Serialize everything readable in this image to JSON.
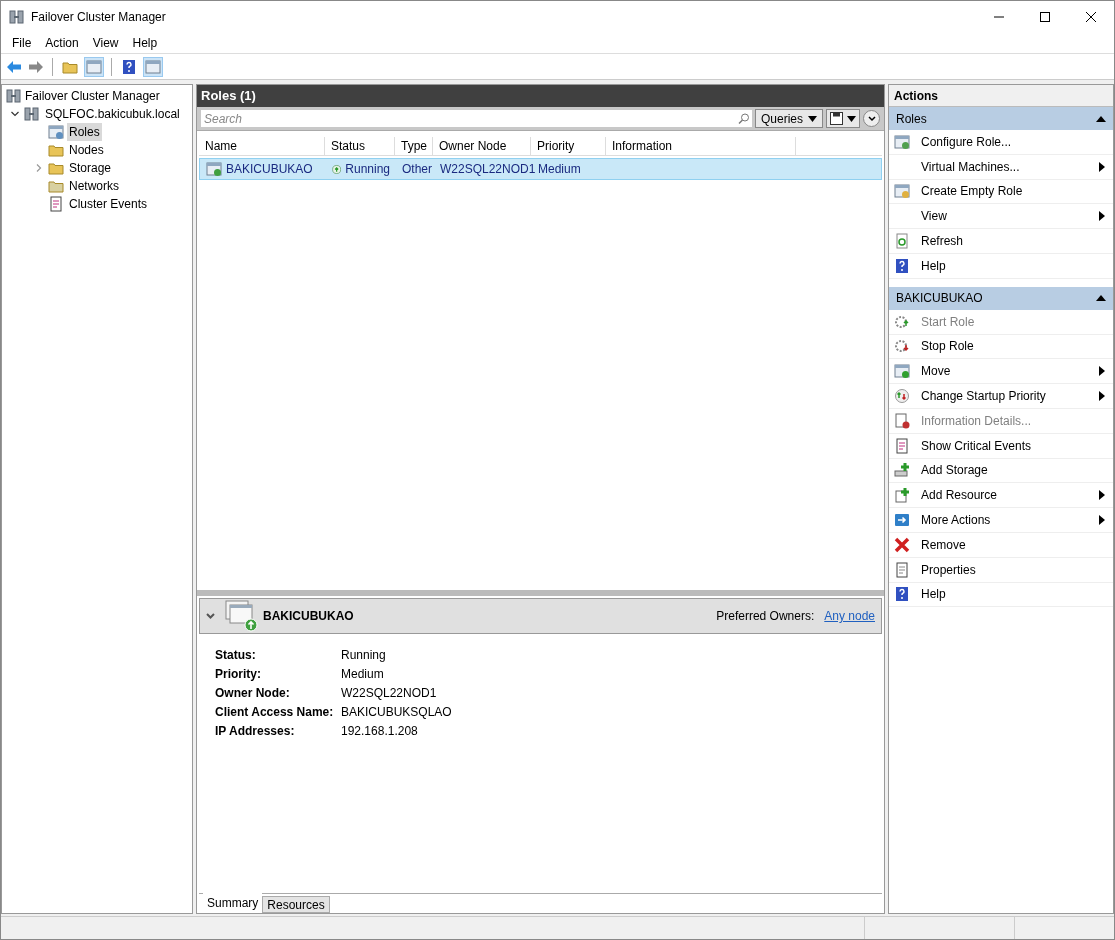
{
  "window": {
    "title": "Failover Cluster Manager"
  },
  "menu": [
    "File",
    "Action",
    "View",
    "Help"
  ],
  "tree": {
    "label": "Failover Cluster Manager",
    "children": [
      {
        "label": "SQLFOC.bakicubuk.local",
        "expanded": true,
        "selected": false,
        "children": [
          {
            "label": "Roles",
            "selected": true
          },
          {
            "label": "Nodes",
            "selected": false
          },
          {
            "label": "Storage",
            "selected": false,
            "expanded": false
          },
          {
            "label": "Networks",
            "selected": false
          },
          {
            "label": "Cluster Events",
            "selected": false
          }
        ]
      }
    ]
  },
  "roles": {
    "title": "Roles (1)",
    "search": {
      "placeholder": "Search"
    },
    "queries_button": "Queries",
    "columns": [
      "Name",
      "Status",
      "Type",
      "Owner Node",
      "Priority",
      "Information"
    ],
    "rows": [
      {
        "name": "BAKICUBUKAO",
        "status": "Running",
        "type": "Other",
        "owner_node": "W22SQL22NOD1",
        "priority": "Medium",
        "selected": true
      }
    ]
  },
  "detail": {
    "name": "BAKICUBUKAO",
    "preferred_owners_label": "Preferred Owners:",
    "preferred_owners_link": "Any node",
    "fields": [
      {
        "label": "Status:",
        "value": "Running"
      },
      {
        "label": "Priority:",
        "value": "Medium"
      },
      {
        "label": "Owner Node:",
        "value": "W22SQL22NOD1"
      },
      {
        "label": "Client Access Name:",
        "value": "BAKICUBUKSQLAO"
      },
      {
        "label": "IP Addresses:",
        "value": "192.168.1.208"
      }
    ],
    "tabs": [
      {
        "label": "Summary",
        "selected": true
      },
      {
        "label": "Resources",
        "selected": false
      }
    ]
  },
  "actions": {
    "title": "Actions",
    "sections": [
      {
        "title": "Roles",
        "expanded": true,
        "items": [
          {
            "label": "Configure Role...",
            "submenu": false,
            "disabled": false
          },
          {
            "label": "Virtual Machines...",
            "submenu": true,
            "disabled": false
          },
          {
            "label": "Create Empty Role",
            "submenu": false,
            "disabled": false
          },
          {
            "label": "View",
            "submenu": true,
            "disabled": false
          },
          {
            "label": "Refresh",
            "submenu": false,
            "disabled": false
          },
          {
            "label": "Help",
            "submenu": false,
            "disabled": false
          }
        ]
      },
      {
        "title": "BAKICUBUKAO",
        "expanded": true,
        "items": [
          {
            "label": "Start Role",
            "submenu": false,
            "disabled": true
          },
          {
            "label": "Stop Role",
            "submenu": false,
            "disabled": false
          },
          {
            "label": "Move",
            "submenu": true,
            "disabled": false
          },
          {
            "label": "Change Startup Priority",
            "submenu": true,
            "disabled": false
          },
          {
            "label": "Information Details...",
            "submenu": false,
            "disabled": true
          },
          {
            "label": "Show Critical Events",
            "submenu": false,
            "disabled": false
          },
          {
            "label": "Add Storage",
            "submenu": false,
            "disabled": false
          },
          {
            "label": "Add Resource",
            "submenu": true,
            "disabled": false
          },
          {
            "label": "More Actions",
            "submenu": true,
            "disabled": false
          },
          {
            "label": "Remove",
            "submenu": false,
            "disabled": false
          },
          {
            "label": "Properties",
            "submenu": false,
            "disabled": false
          },
          {
            "label": "Help",
            "submenu": false,
            "disabled": false
          }
        ]
      }
    ]
  }
}
